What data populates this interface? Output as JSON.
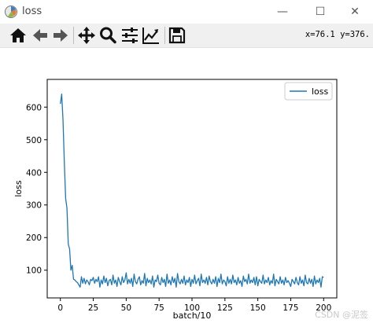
{
  "window": {
    "title": "loss",
    "controls": {
      "minimize": "—",
      "maximize": "☐",
      "close": "✕"
    }
  },
  "toolbar": {
    "buttons": [
      "home-icon",
      "back-arrow-icon",
      "forward-arrow-icon",
      "pan-icon",
      "zoom-icon",
      "subplots-config-icon",
      "edit-axes-icon",
      "save-icon"
    ],
    "coordinates": "x=76.1  y=376."
  },
  "chart_data": {
    "type": "line",
    "title": "",
    "xlabel": "batch/10",
    "ylabel": "loss",
    "xlim": [
      -10,
      210
    ],
    "ylim": [
      15,
      685
    ],
    "xticks": [
      0,
      25,
      50,
      75,
      100,
      125,
      150,
      175,
      200
    ],
    "yticks": [
      100,
      200,
      300,
      400,
      500,
      600
    ],
    "grid": false,
    "legend_position": "upper right",
    "color": "#1f77b4",
    "series": [
      {
        "name": "loss",
        "x": [
          0,
          1,
          2,
          3,
          4,
          5,
          6,
          7,
          8,
          9,
          10,
          11,
          12,
          13,
          14,
          15,
          16,
          17,
          18,
          19,
          20,
          21,
          22,
          23,
          24,
          25,
          26,
          27,
          28,
          29,
          30,
          31,
          32,
          33,
          34,
          35,
          36,
          37,
          38,
          39,
          40,
          41,
          42,
          43,
          44,
          45,
          46,
          47,
          48,
          49,
          50,
          51,
          52,
          53,
          54,
          55,
          56,
          57,
          58,
          59,
          60,
          61,
          62,
          63,
          64,
          65,
          66,
          67,
          68,
          69,
          70,
          71,
          72,
          73,
          74,
          75,
          76,
          77,
          78,
          79,
          80,
          81,
          82,
          83,
          84,
          85,
          86,
          87,
          88,
          89,
          90,
          91,
          92,
          93,
          94,
          95,
          96,
          97,
          98,
          99,
          100,
          101,
          102,
          103,
          104,
          105,
          106,
          107,
          108,
          109,
          110,
          111,
          112,
          113,
          114,
          115,
          116,
          117,
          118,
          119,
          120,
          121,
          122,
          123,
          124,
          125,
          126,
          127,
          128,
          129,
          130,
          131,
          132,
          133,
          134,
          135,
          136,
          137,
          138,
          139,
          140,
          141,
          142,
          143,
          144,
          145,
          146,
          147,
          148,
          149,
          150,
          151,
          152,
          153,
          154,
          155,
          156,
          157,
          158,
          159,
          160,
          161,
          162,
          163,
          164,
          165,
          166,
          167,
          168,
          169,
          170,
          171,
          172,
          173,
          174,
          175,
          176,
          177,
          178,
          179,
          180,
          181,
          182,
          183,
          184,
          185,
          186,
          187,
          188,
          189,
          190,
          191,
          192,
          193,
          194,
          195,
          196,
          197,
          198,
          199,
          200
        ],
        "values": [
          610,
          640,
          560,
          430,
          320,
          290,
          180,
          165,
          100,
          115,
          72,
          70,
          65,
          62,
          55,
          48,
          80,
          60,
          75,
          58,
          70,
          65,
          55,
          72,
          68,
          78,
          60,
          72,
          65,
          80,
          48,
          70,
          58,
          82,
          62,
          75,
          52,
          68,
          72,
          55,
          85,
          60,
          70,
          50,
          78,
          65,
          55,
          80,
          62,
          70,
          92,
          58,
          72,
          60,
          75,
          50,
          88,
          65,
          58,
          72,
          80,
          55,
          68,
          60,
          90,
          52,
          75,
          62,
          70,
          58,
          82,
          48,
          70,
          65,
          85,
          60,
          55,
          78,
          62,
          72,
          50,
          88,
          60,
          70,
          55,
          80,
          62,
          75,
          48,
          90,
          65,
          58,
          72,
          60,
          82,
          55,
          70,
          62,
          78,
          50,
          72,
          60,
          85,
          58,
          68,
          75,
          52,
          88,
          62,
          70,
          60,
          78,
          55,
          82,
          65,
          58,
          72,
          60,
          80,
          50,
          75,
          62,
          88,
          58,
          70,
          65,
          52,
          80,
          60,
          72,
          58,
          85,
          62,
          70,
          55,
          78,
          60,
          68,
          50,
          82,
          65,
          72,
          58,
          88,
          60,
          70,
          62,
          78,
          55,
          80,
          52,
          72,
          65,
          60,
          85,
          58,
          70,
          62,
          78,
          55,
          68,
          60,
          88,
          52,
          72,
          65,
          58,
          80,
          60,
          70,
          55,
          78,
          62,
          68,
          60,
          50,
          72,
          65,
          58,
          78,
          62,
          55,
          80,
          60,
          70,
          52,
          85,
          62,
          58,
          75,
          60,
          72,
          50,
          82,
          58,
          70,
          62,
          75,
          48,
          80,
          78
        ]
      }
    ]
  },
  "watermark": "CSDN @泥签"
}
